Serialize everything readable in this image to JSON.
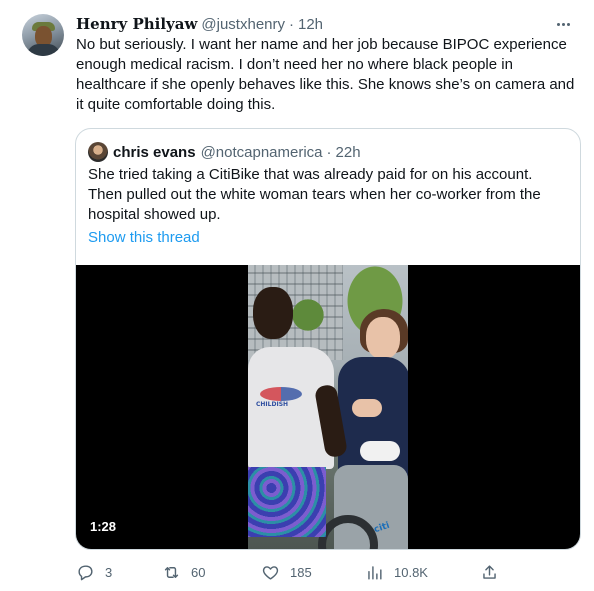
{
  "tweet": {
    "author": {
      "display_name": "Henry Philyaw",
      "handle": "@justxhenry",
      "time": "12h"
    },
    "separator": "·",
    "text": "No but seriously. I want her name and her job because BIPOC experience enough medical racism. I don’t need her no where black people in healthcare if she openly behaves like this. She knows she’s on camera and it quite comfortable doing this.",
    "more_icon": "more-horizontal-icon"
  },
  "quoted_tweet": {
    "author": {
      "display_name": "chris evans",
      "handle": "@notcapnamerica",
      "time": "22h"
    },
    "text": "She tried taking a CitiBike that was already paid for on his account. Then pulled out the white woman tears when her co-worker from the hospital showed up.",
    "show_thread_label": "Show this thread",
    "video": {
      "duration": "1:28",
      "shirt_logo_text": "CHILDISH",
      "bike_brand_text": "citi"
    }
  },
  "actions": {
    "reply": {
      "icon": "reply-icon",
      "count": "3"
    },
    "retweet": {
      "icon": "retweet-icon",
      "count": "60"
    },
    "like": {
      "icon": "heart-icon",
      "count": "185"
    },
    "views": {
      "icon": "views-chart-icon",
      "count": "10.8K"
    },
    "share": {
      "icon": "share-icon"
    }
  },
  "colors": {
    "text_primary": "#0f1419",
    "text_secondary": "#536471",
    "link": "#1d9bf0",
    "border": "#cfd9de"
  }
}
